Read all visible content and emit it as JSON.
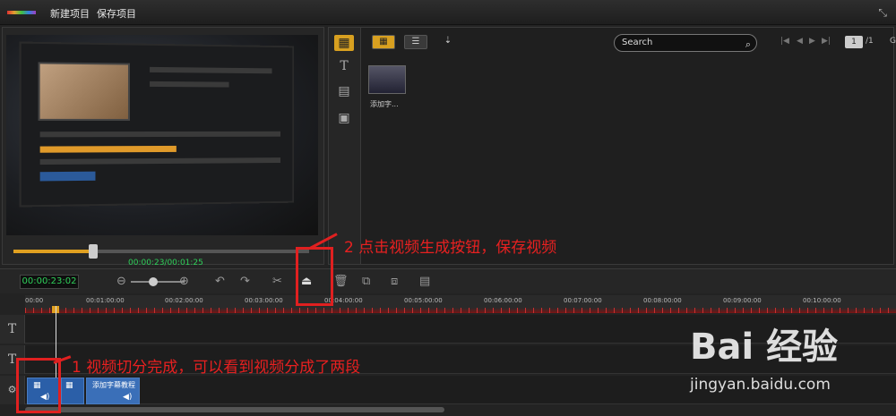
{
  "menu": {
    "new_project": "新建项目",
    "save_project": "保存项目"
  },
  "preview": {
    "timecode": "00:00:23/00:01:25",
    "play_icon": "play-icon",
    "progress": 0.27
  },
  "library": {
    "search_placeholder": "Search",
    "page_current": "1",
    "page_total": "/1",
    "go_label": "GO",
    "thumb_label": "添加字..."
  },
  "timeline": {
    "timecode": "00:00:23:02",
    "ruler": [
      "00:00",
      "00:01:00:00",
      "00:02:00:00",
      "00:03:00:00",
      "00:04:00:00",
      "00:05:00:00",
      "00:06:00:00",
      "00:07:00:00",
      "00:08:00:00",
      "00:09:00:00",
      "00:10:00:00"
    ],
    "track_titles": [
      "T",
      "T"
    ],
    "clip_label": "添加字幕教程"
  },
  "annotations": {
    "step2": "2 点击视频生成按钮，保存视频",
    "step1": "1 视频切分完成，可以看到视频分成了两段"
  },
  "watermark": {
    "brand": "Bai 经验",
    "url": "jingyan.baidu.com"
  }
}
